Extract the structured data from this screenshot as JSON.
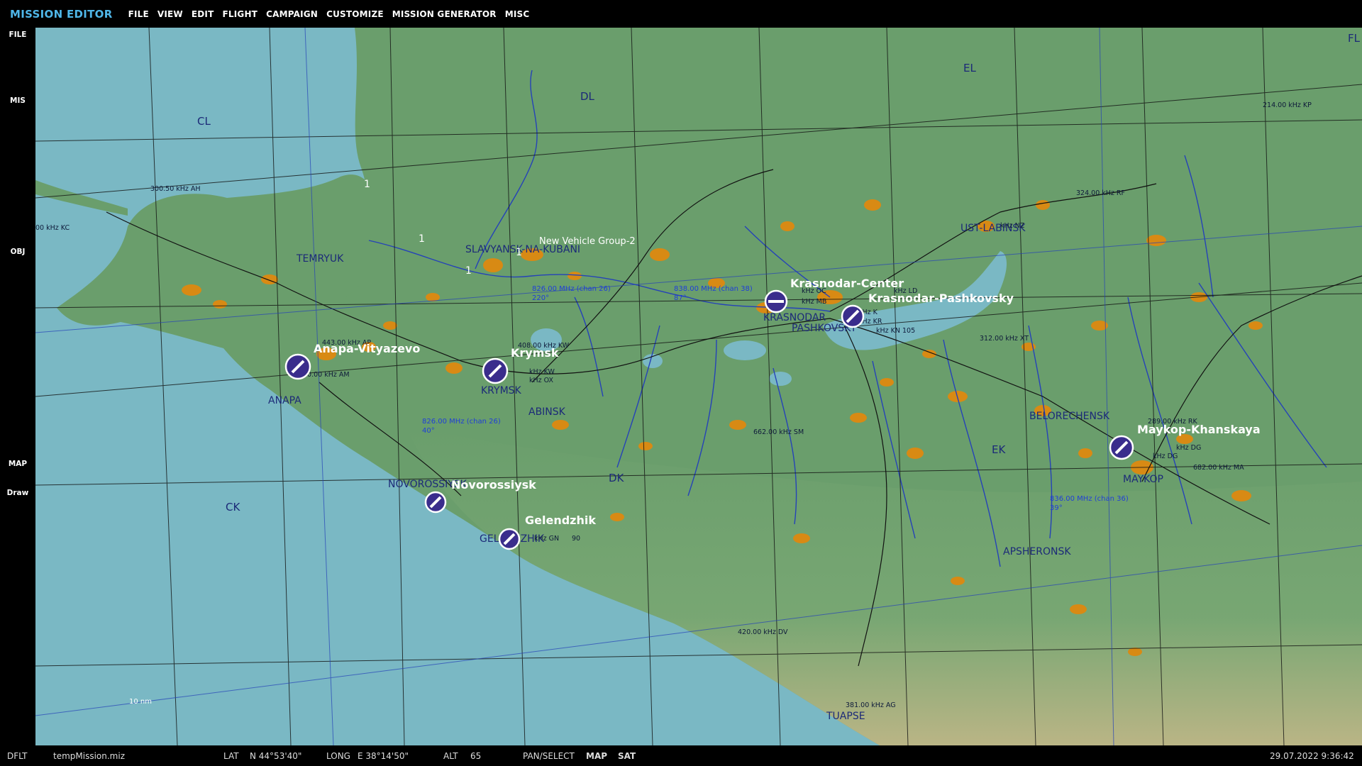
{
  "app_title": "MISSION EDITOR",
  "menu": [
    "FILE",
    "VIEW",
    "EDIT",
    "FLIGHT",
    "CAMPAIGN",
    "CUSTOMIZE",
    "MISSION GENERATOR",
    "MISC"
  ],
  "sidebar": {
    "file": "FILE",
    "mis": "MIS",
    "obj": "OBJ",
    "map": "MAP",
    "draw": "Draw",
    "fl": "FL"
  },
  "grid_labels": {
    "cl": "CL",
    "dl": "DL",
    "el": "EL",
    "ck": "CK",
    "dk": "DK",
    "ek": "EK"
  },
  "cities": {
    "temryuk": "TEMRYUK",
    "slavyansk": "SLAVYANSK-NA-KUBANI",
    "anapa": "ANAPA",
    "krymsk": "KRYMSK",
    "abinsk": "ABINSK",
    "novorossiysk": "NOVOROSSIYSK",
    "gelendzhik": "GELENDZHIK",
    "krasnodar": "KRASNODAR",
    "pashkovsky": "PASHKOVSKY",
    "ust_labinsk": "UST-LABINSK",
    "belorechensk": "BELORECHENSK",
    "maykop": "MAYKOP",
    "apsheronsk": "APSHERONSK",
    "tuapse": "TUAPSE"
  },
  "airfields": {
    "anapa": "Anapa-Vityazevo",
    "krymsk": "Krymsk",
    "krasnodar_center": "Krasnodar-Center",
    "krasnodar_pashkovsky": "Krasnodar-Pashkovsky",
    "novorossiysk": "Novorossiysk",
    "gelendzhik": "Gelendzhik",
    "maykop": "Maykop-Khanskaya"
  },
  "beacons": {
    "ah": "300.50 kHz AH",
    "kc": "00 kHz KC",
    "ap": "443.00 kHz AP",
    "am": "30.00 kHz AM",
    "kw1": "408.00 kHz KW",
    "kw2": "kHz KW",
    "ox": "kHz OX",
    "sm": "662.00 kHz SM",
    "gn": "kHz GN",
    "dv": "420.00 kHz DV",
    "ag": "381.00 kHz AG",
    "kp": "214.00 kHz KP",
    "rf": "324.00 kHz RF",
    "nz": "kHz NZ",
    "ld": "kHz LD",
    "oc": "kHz OC",
    "mb": "kHz MB",
    "k": "kHz K",
    "kr": "kHz KR",
    "kn": "kHz KN 105",
    "xt": "312.00 kHz XT",
    "rk": "289.00 kHz RK",
    "dg1": "kHz DG",
    "dg2": "kHz DG",
    "ma": "682.00 kHz MA"
  },
  "tacan": {
    "t26": "826.00 MHz (chan 26)",
    "t26_hdg": "220°",
    "t38": "838.00 MHz (chan 38)",
    "t38_hdg": "87°",
    "t26b": "826.00 MHz (chan 26)",
    "t26b_hdg": "40°",
    "t36": "836.00 MHz (chan 36)",
    "t36_hdg": "39°"
  },
  "misc_labels": {
    "gn_num": "90",
    "unit_group": "New Vehicle Group-2",
    "wp1": "1",
    "wp2": "1",
    "wp3": "1",
    "wp4": "1"
  },
  "scale": "10 nm",
  "status": {
    "dflt": "DFLT",
    "file": "tempMission.miz",
    "lat_label": "LAT",
    "lat": "N 44°53'40\"",
    "long_label": "LONG",
    "long": "E 38°14'50\"",
    "alt_label": "ALT",
    "alt": "65",
    "pan": "PAN/SELECT",
    "map": "MAP",
    "sat": "SAT",
    "datetime": "29.07.2022 9:36:42"
  },
  "colors": {
    "sea": "#7ab8c4",
    "land": "#6a9e6c",
    "urban": "#d88a14",
    "river": "#2542b8",
    "accent": "#4fb6e8"
  }
}
